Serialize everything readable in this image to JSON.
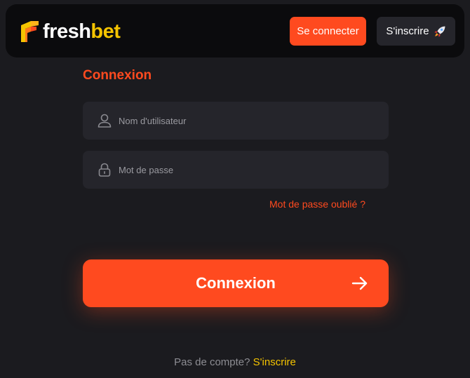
{
  "header": {
    "logo_text_part1": "fresh",
    "logo_text_part2": "bet",
    "login_button": "Se connecter",
    "signup_button": "S'inscrire",
    "signup_icon": "rocket-icon"
  },
  "form": {
    "title": "Connexion",
    "username_placeholder": "Nom d'utilisateur",
    "username_value": "",
    "username_icon": "user-icon",
    "password_placeholder": "Mot de passe",
    "password_value": "",
    "password_icon": "lock-icon",
    "forgot_link": "Mot de passe oublié ?",
    "submit_label": "Connexion",
    "submit_icon": "arrow-right-icon"
  },
  "footer": {
    "prompt": "Pas de compte?",
    "signup_link": "S'inscrire"
  },
  "colors": {
    "accent": "#ff4a1f",
    "brand_yellow": "#f5c400",
    "background": "#1b1b1f",
    "header_bg": "#0b0b0d",
    "field_bg": "#25252b"
  }
}
